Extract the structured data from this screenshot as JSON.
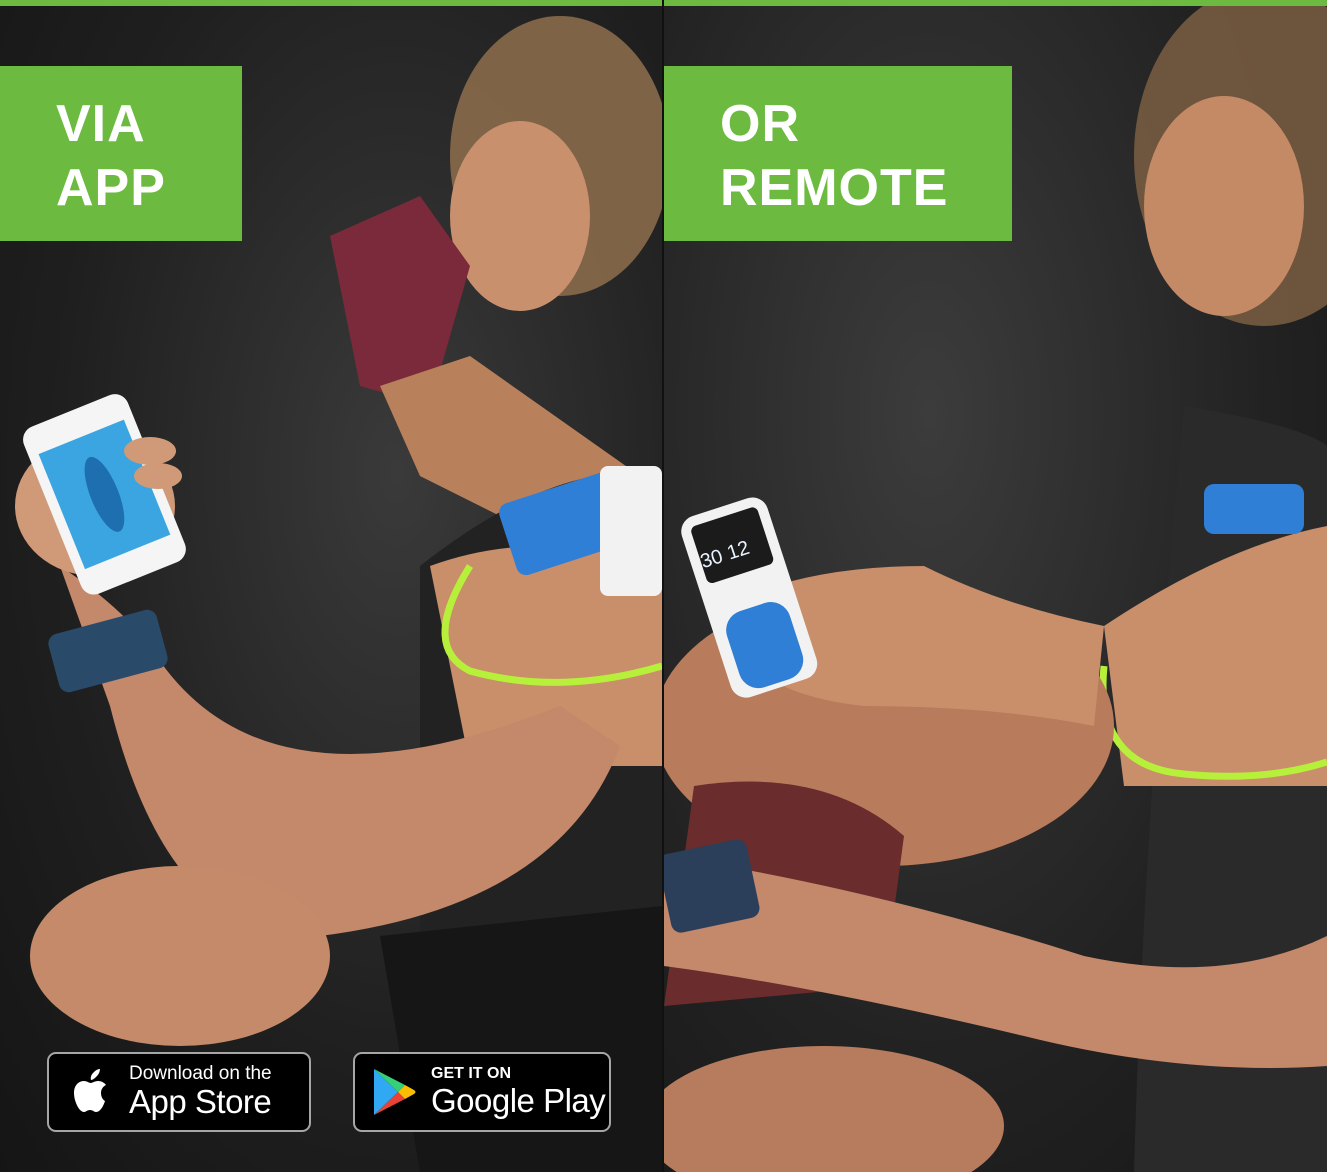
{
  "banners": {
    "left": {
      "line1": "VIA",
      "line2": "APP"
    },
    "right": {
      "line1": "OR",
      "line2": "REMOTE"
    }
  },
  "badges": {
    "apple": {
      "small": "Download on the",
      "big": "App Store",
      "icon": "apple-icon"
    },
    "google": {
      "small": "GET IT ON",
      "big": "Google Play",
      "icon": "google-play-icon"
    }
  },
  "remote_display": {
    "left": "30",
    "right": "12"
  },
  "colors": {
    "accent": "#6cba3f",
    "badge_bg": "#000000",
    "device_blue": "#2f7fd6",
    "lead_wire": "#b7f03a"
  }
}
